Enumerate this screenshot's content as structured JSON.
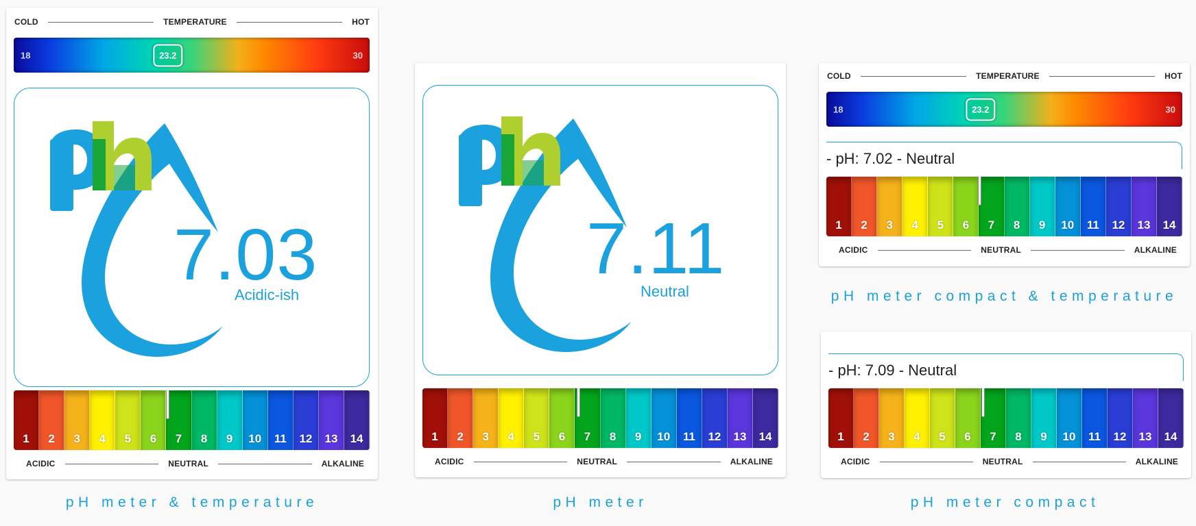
{
  "colors": {
    "accent": "#1ba1dd",
    "logo_h": "#aecf2e",
    "logo_overlap": "#1aa537",
    "ph_scale": [
      "#a01008",
      "#f0562a",
      "#f5b21a",
      "#fff100",
      "#cfe31a",
      "#8ad41c",
      "#03a51c",
      "#00b864",
      "#00c8c8",
      "#0591d8",
      "#0a57e0",
      "#2a3ed6",
      "#5a36dc",
      "#3c2a9e"
    ]
  },
  "scale_words": {
    "cold": "COLD",
    "temperature": "TEMPERATURE",
    "hot": "HOT",
    "acidic": "ACIDIC",
    "neutral": "NEUTRAL",
    "alkaline": "ALKALINE"
  },
  "ph_numbers": [
    "1",
    "2",
    "3",
    "4",
    "5",
    "6",
    "7",
    "8",
    "9",
    "10",
    "11",
    "12",
    "13",
    "14"
  ],
  "card1": {
    "temp_min": "18",
    "temp_max": "30",
    "temp_value": "23.2",
    "temp_fraction": 0.433,
    "ph_value": "7.03",
    "ph_status": "Acidic-ish",
    "ph_level": 7.03,
    "caption": "pH meter & temperature"
  },
  "card2": {
    "ph_value": "7.11",
    "ph_status": "Neutral",
    "ph_level": 7.11,
    "caption": "pH meter"
  },
  "card3": {
    "temp_min": "18",
    "temp_max": "30",
    "temp_value": "23.2",
    "temp_fraction": 0.433,
    "title": "- pH: 7.02 - Neutral",
    "ph_level": 7.02,
    "caption": "pH meter compact & temperature"
  },
  "card4": {
    "title": "- pH: 7.09 - Neutral",
    "ph_level": 7.09,
    "caption": "pH meter compact"
  }
}
